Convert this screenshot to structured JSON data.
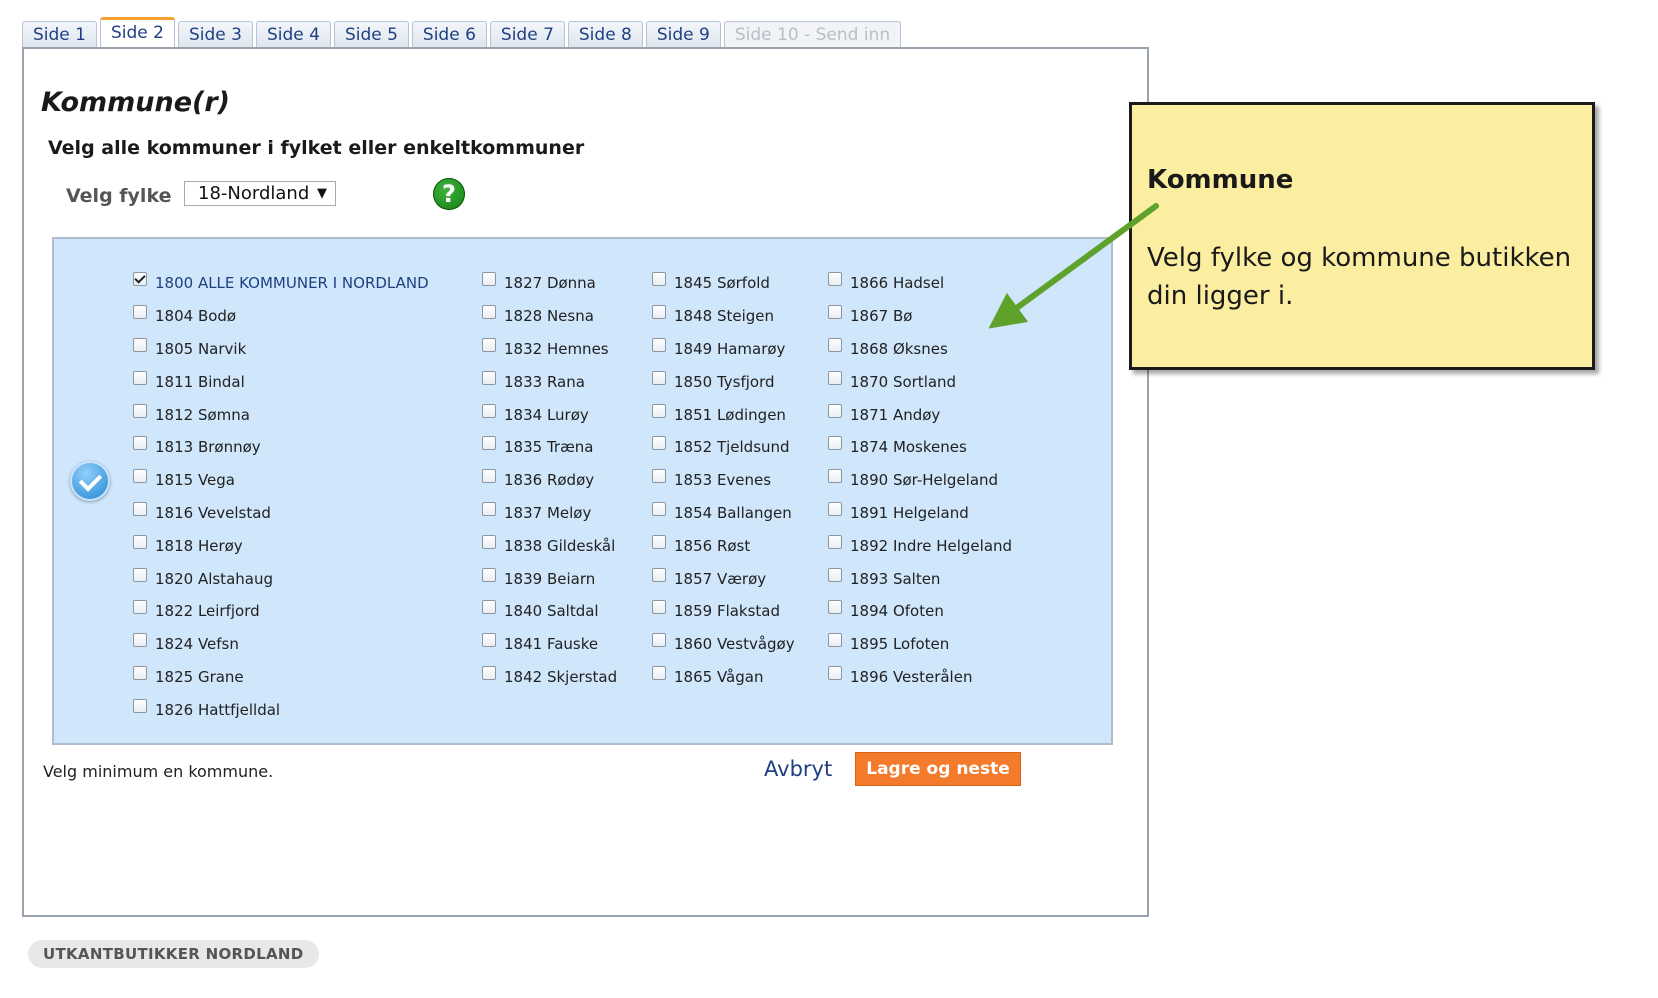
{
  "tabs": [
    {
      "label": "Side 1",
      "state": "normal"
    },
    {
      "label": "Side 2",
      "state": "active"
    },
    {
      "label": "Side 3",
      "state": "normal"
    },
    {
      "label": "Side 4",
      "state": "normal"
    },
    {
      "label": "Side 5",
      "state": "normal"
    },
    {
      "label": "Side 6",
      "state": "normal"
    },
    {
      "label": "Side 7",
      "state": "normal"
    },
    {
      "label": "Side 8",
      "state": "normal"
    },
    {
      "label": "Side 9",
      "state": "normal"
    },
    {
      "label": "Side 10 - Send inn",
      "state": "disabled"
    }
  ],
  "page": {
    "title": "Kommune(r)",
    "subtitle": "Velg alle kommuner i fylket eller enkeltkommuner",
    "fylke_label": "Velg fylke",
    "fylke_value": "18-Nordland",
    "help_icon": "?"
  },
  "kommuner": {
    "columns": [
      [
        {
          "label": "1800 ALLE KOMMUNER I NORDLAND",
          "checked": true
        },
        {
          "label": "1804 Bodø",
          "checked": false
        },
        {
          "label": "1805 Narvik",
          "checked": false
        },
        {
          "label": "1811 Bindal",
          "checked": false
        },
        {
          "label": "1812 Sømna",
          "checked": false
        },
        {
          "label": "1813 Brønnøy",
          "checked": false
        },
        {
          "label": "1815 Vega",
          "checked": false
        },
        {
          "label": "1816 Vevelstad",
          "checked": false
        },
        {
          "label": "1818 Herøy",
          "checked": false
        },
        {
          "label": "1820 Alstahaug",
          "checked": false
        },
        {
          "label": "1822 Leirfjord",
          "checked": false
        },
        {
          "label": "1824 Vefsn",
          "checked": false
        },
        {
          "label": "1825 Grane",
          "checked": false
        },
        {
          "label": "1826 Hattfjelldal",
          "checked": false
        }
      ],
      [
        {
          "label": "1827 Dønna",
          "checked": false
        },
        {
          "label": "1828 Nesna",
          "checked": false
        },
        {
          "label": "1832 Hemnes",
          "checked": false
        },
        {
          "label": "1833 Rana",
          "checked": false
        },
        {
          "label": "1834 Lurøy",
          "checked": false
        },
        {
          "label": "1835 Træna",
          "checked": false
        },
        {
          "label": "1836 Rødøy",
          "checked": false
        },
        {
          "label": "1837 Meløy",
          "checked": false
        },
        {
          "label": "1838 Gildeskål",
          "checked": false
        },
        {
          "label": "1839 Beiarn",
          "checked": false
        },
        {
          "label": "1840 Saltdal",
          "checked": false
        },
        {
          "label": "1841 Fauske",
          "checked": false
        },
        {
          "label": "1842 Skjerstad",
          "checked": false
        }
      ],
      [
        {
          "label": "1845 Sørfold",
          "checked": false
        },
        {
          "label": "1848 Steigen",
          "checked": false
        },
        {
          "label": "1849 Hamarøy",
          "checked": false
        },
        {
          "label": "1850 Tysfjord",
          "checked": false
        },
        {
          "label": "1851 Lødingen",
          "checked": false
        },
        {
          "label": "1852 Tjeldsund",
          "checked": false
        },
        {
          "label": "1853 Evenes",
          "checked": false
        },
        {
          "label": "1854 Ballangen",
          "checked": false
        },
        {
          "label": "1856 Røst",
          "checked": false
        },
        {
          "label": "1857 Værøy",
          "checked": false
        },
        {
          "label": "1859 Flakstad",
          "checked": false
        },
        {
          "label": "1860 Vestvågøy",
          "checked": false
        },
        {
          "label": "1865 Vågan",
          "checked": false
        }
      ],
      [
        {
          "label": "1866 Hadsel",
          "checked": false
        },
        {
          "label": "1867 Bø",
          "checked": false
        },
        {
          "label": "1868 Øksnes",
          "checked": false
        },
        {
          "label": "1870 Sortland",
          "checked": false
        },
        {
          "label": "1871 Andøy",
          "checked": false
        },
        {
          "label": "1874 Moskenes",
          "checked": false
        },
        {
          "label": "1890 Sør-Helgeland",
          "checked": false
        },
        {
          "label": "1891 Helgeland",
          "checked": false
        },
        {
          "label": "1892 Indre Helgeland",
          "checked": false
        },
        {
          "label": "1893 Salten",
          "checked": false
        },
        {
          "label": "1894 Ofoten",
          "checked": false
        },
        {
          "label": "1895 Lofoten",
          "checked": false
        },
        {
          "label": "1896 Vesterålen",
          "checked": false
        }
      ]
    ]
  },
  "footer": {
    "hint": "Velg minimum en kommune.",
    "cancel_label": "Avbryt",
    "save_label": "Lagre og neste",
    "brand_pill": "UTKANTBUTIKKER NORDLAND"
  },
  "callout": {
    "title": "Kommune",
    "text": "Velg fylke og kommune butikken din ligger i."
  },
  "colors": {
    "accent_orange": "#f47a2c",
    "link_blue": "#1f3f82",
    "list_background": "#cfe6fb",
    "callout_background": "#fbeea0",
    "arrow_green": "#5ea22b"
  }
}
